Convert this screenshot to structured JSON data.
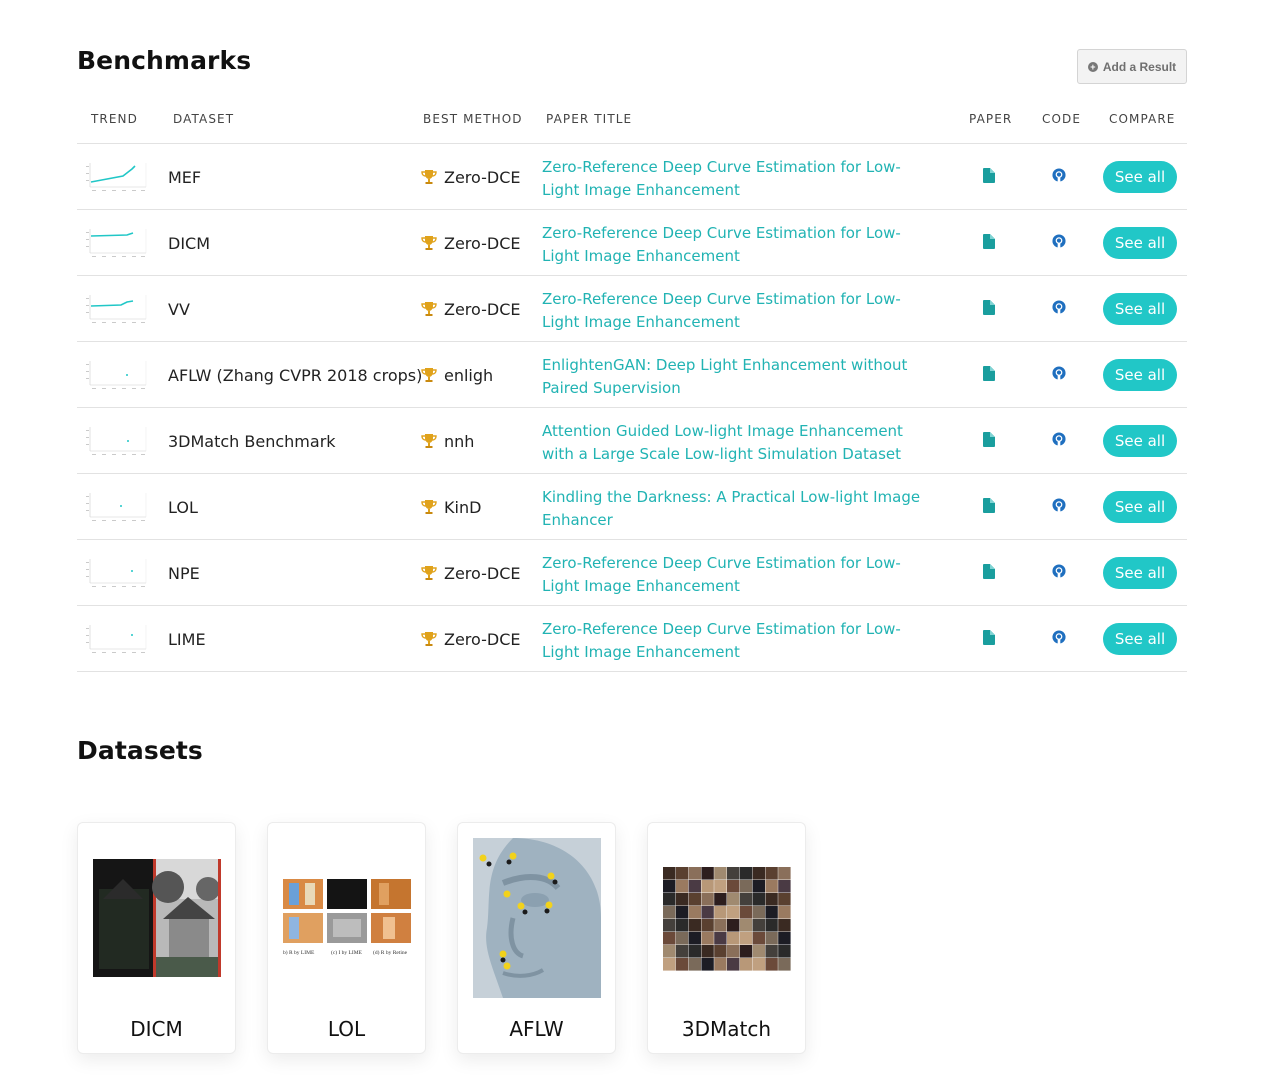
{
  "benchmarks": {
    "title": "Benchmarks",
    "add_result_label": "Add a Result",
    "columns": {
      "trend": "TREND",
      "dataset": "DATASET",
      "best_method": "BEST METHOD",
      "paper_title": "PAPER TITLE",
      "paper": "PAPER",
      "code": "CODE",
      "compare": "COMPARE"
    },
    "rows": [
      {
        "dataset": "MEF",
        "method": "Zero-DCE",
        "paper": "Zero-Reference Deep Curve Estimation for Low-Light Image Enhancement",
        "compare": "See all"
      },
      {
        "dataset": "DICM",
        "method": "Zero-DCE",
        "paper": "Zero-Reference Deep Curve Estimation for Low-Light Image Enhancement",
        "compare": "See all"
      },
      {
        "dataset": "VV",
        "method": "Zero-DCE",
        "paper": "Zero-Reference Deep Curve Estimation for Low-Light Image Enhancement",
        "compare": "See all"
      },
      {
        "dataset": "AFLW (Zhang CVPR 2018 crops)",
        "method": "enligh",
        "paper": "EnlightenGAN: Deep Light Enhancement without Paired Supervision",
        "compare": "See all"
      },
      {
        "dataset": "3DMatch Benchmark",
        "method": "nnh",
        "paper": "Attention Guided Low-light Image Enhancement with a Large Scale Low-light Simulation Dataset",
        "compare": "See all"
      },
      {
        "dataset": "LOL",
        "method": "KinD",
        "paper": "Kindling the Darkness: A Practical Low-light Image Enhancer",
        "compare": "See all"
      },
      {
        "dataset": "NPE",
        "method": "Zero-DCE",
        "paper": "Zero-Reference Deep Curve Estimation for Low-Light Image Enhancement",
        "compare": "See all"
      },
      {
        "dataset": "LIME",
        "method": "Zero-DCE",
        "paper": "Zero-Reference Deep Curve Estimation for Low-Light Image Enhancement",
        "compare": "See all"
      }
    ]
  },
  "datasets": {
    "title": "Datasets",
    "cards": [
      {
        "label": "DICM"
      },
      {
        "label": "LOL",
        "captions": [
          "b) R by LIME",
          "(c) I by LIME",
          "(d) R by Retine"
        ]
      },
      {
        "label": "AFLW"
      },
      {
        "label": "3DMatch"
      }
    ]
  },
  "colors": {
    "accent": "#21c7c7",
    "link": "#21b3b3",
    "trophy": "#e0a21b"
  },
  "icons": {
    "add": "plus-circle-icon",
    "trophy": "trophy-icon",
    "paper": "file-icon",
    "code": "github-icon"
  }
}
